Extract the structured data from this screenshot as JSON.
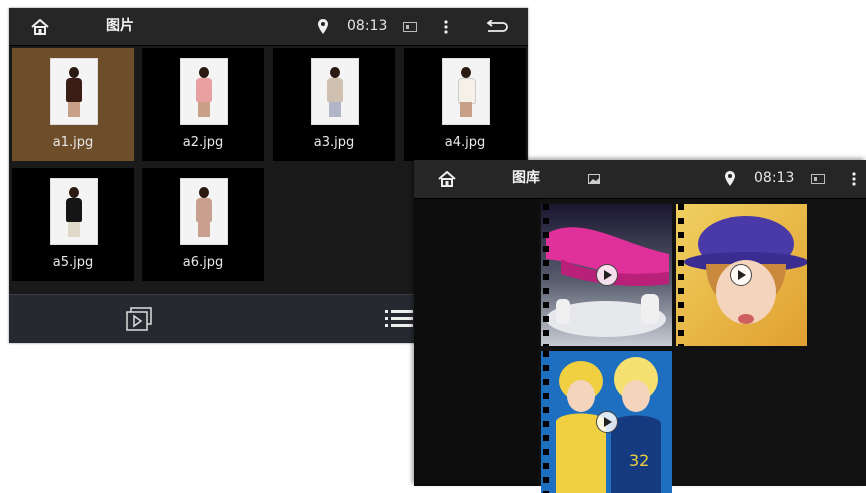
{
  "window1": {
    "title": "图片",
    "time": "08:13",
    "icons": {
      "home": "home-icon",
      "location": "location-pin-icon",
      "storage": "sd-card-icon",
      "menu": "more-vert-icon",
      "back": "back-icon",
      "slideshow": "slideshow-icon",
      "list": "list-view-icon"
    },
    "files": [
      {
        "name": "a1.jpg",
        "selected": true,
        "top_color": "#3a1e16"
      },
      {
        "name": "a2.jpg",
        "selected": false,
        "top_color": "#e8a0a0"
      },
      {
        "name": "a3.jpg",
        "selected": false,
        "top_color": "#d0c0b0"
      },
      {
        "name": "a4.jpg",
        "selected": false,
        "top_color": "#f5f0e8"
      },
      {
        "name": "a5.jpg",
        "selected": false,
        "top_color": "#151515"
      },
      {
        "name": "a6.jpg",
        "selected": false,
        "top_color": "#c9a090"
      }
    ]
  },
  "window2": {
    "title": "图库",
    "time": "08:13",
    "icons": {
      "home": "home-icon",
      "picture": "image-icon",
      "location": "location-pin-icon",
      "storage": "sd-card-icon",
      "menu": "more-vert-icon",
      "play": "play-icon"
    },
    "videos": [
      {
        "name": "video-1",
        "bg": "#8a8f98",
        "accent": "#e0309a"
      },
      {
        "name": "video-2",
        "bg": "#e8c24a",
        "accent": "#4a3aa8"
      },
      {
        "name": "video-3",
        "bg": "#1f6fc0",
        "accent": "#f0d040"
      }
    ]
  },
  "colors": {
    "selected_tile": "#6e4d2a",
    "statusbar": "#262626",
    "toolbar": "#262a30"
  }
}
